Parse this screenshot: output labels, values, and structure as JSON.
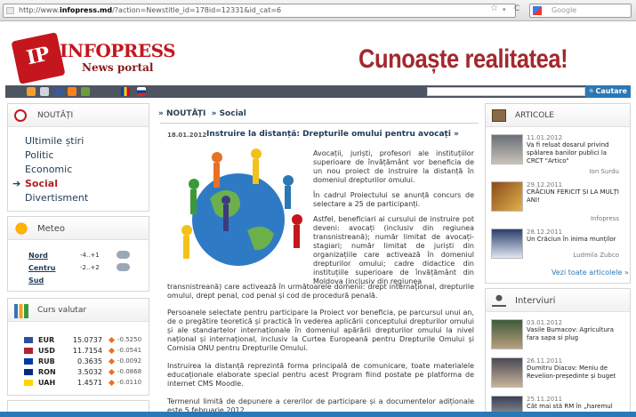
{
  "browser": {
    "url_prefix": "http://www.",
    "url_domain": "infopress.md",
    "url_rest": "/?action=Newstitle_id=178id=12331&id_cat=6",
    "search_placeholder": "Google",
    "star": "☆",
    "dropdown": "▾",
    "reload": "C"
  },
  "header": {
    "logo_mark": "IP",
    "logo_name": "INFOPRESS",
    "logo_sub": "News portal",
    "slogan": "Cunoaște realitatea!"
  },
  "navbar": {
    "search_button": "Cautare",
    "search_glyph": "🔍"
  },
  "left": {
    "nouta_title": "NOUTĂȚI",
    "items": [
      {
        "label": "Ultimile știri",
        "active": false
      },
      {
        "label": "Politic",
        "active": false
      },
      {
        "label": "Economic",
        "active": false
      },
      {
        "label": "Social",
        "active": true
      },
      {
        "label": "Divertisment",
        "active": false
      }
    ],
    "arrow": "➔",
    "meteo_title": "Meteo",
    "meteo": [
      {
        "city": "Nord",
        "temp": "-4..+1"
      },
      {
        "city": "Centru",
        "temp": "-2..+2"
      },
      {
        "city": "Sud",
        "temp": ""
      }
    ],
    "curs_title": "Curs valutar",
    "currencies": [
      {
        "code": "EUR",
        "rate": "15.0737",
        "change": "-0.5250",
        "color": "#2b4fa3"
      },
      {
        "code": "USD",
        "rate": "11.7154",
        "change": "-0.0541",
        "color": "#b22234"
      },
      {
        "code": "RUB",
        "rate": "0.3635",
        "change": "-0.0092",
        "color": "#0039a6"
      },
      {
        "code": "RON",
        "rate": "3.5032",
        "change": "-0.0868",
        "color": "#002b7f"
      },
      {
        "code": "UAH",
        "rate": "1.4571",
        "change": "-0.0110",
        "color": "#ffd500"
      }
    ]
  },
  "center": {
    "crumb_1": "» NOUTĂȚI",
    "crumb_2": "» Social",
    "date": "18.01.2012",
    "title": "Instruire la distanță: Drepturile omului pentru avocați »",
    "p1": "Avocații, juriști, profesori ale instituțiilor superioare de învățământ vor beneficia de un nou proiect de instruire la distanță în domeniul drepturilor omului.",
    "p2": "În cadrul Proiectului se anunță concurs de selectare a 25 de participanți.",
    "p3": "Astfel, beneficiari ai cursului de instruire pot deveni: avocați (inclusiv din regiunea transnistreană); număr limitat de avocați-stagiari; număr limitat de juriști din organizațiile care activează în domeniul drepturilor omului; cadre didactice din instituțiile superioare de învățământ din Moldova (inclusiv din regiunea",
    "p3b": "transnistreană) care activează în următoarele domenii: drept internațional, drepturile omului, drept penal, cod penal și cod de procedură penală.",
    "p4": "Persoanele selectate pentru participare la Proiect vor beneficia, pe parcursul unui an, de o pregătire teoretică și practică în vederea aplicării conceptului drepturilor omului și ale standartelor internaționale în domeniul apărării drepturilor omului la nivel național și internațional, inclusiv la Curtea Europeană pentru Drepturile Omului și Comisia ONU pentru Drepturile Omului.",
    "p5": "Instruirea la distanță reprezintă forma principală de comunicare, toate materialele educaționale elaborate special pentru acest Program fiind postate pe platforma de internet CMS Moodle.",
    "p6": "Termenul limită de depunere a cererilor de participare și a documentelor adiționale este 5 februarie 2012."
  },
  "right": {
    "articole_title": "ARTICOLE",
    "articles": [
      {
        "date": "11.01.2012",
        "title": "Va fi reluat dosarul privind spălarea banilor publici la CRCT \"Artico\"",
        "author": "Ion Surdu"
      },
      {
        "date": "29.12.2011",
        "title": "CRĂCIUN FERICIT ȘI LA MULȚI ANI!",
        "author": "Infopress"
      },
      {
        "date": "28.12.2011",
        "title": "Un Crăciun în inima munților",
        "author": "Ludmila Zubco"
      }
    ],
    "toate": "Vezi toate articolele »",
    "interviuri_title": "Interviuri",
    "interviews": [
      {
        "date": "03.01.2012",
        "title": "Vasile Bumacov: Agricultura fara sapa si plug"
      },
      {
        "date": "26.11.2011",
        "title": "Dumitru Diacov: Meniu de Revelion-președinte și buget"
      },
      {
        "date": "25.11.2011",
        "title": "Cât mai stă RM în „haremul"
      }
    ]
  }
}
